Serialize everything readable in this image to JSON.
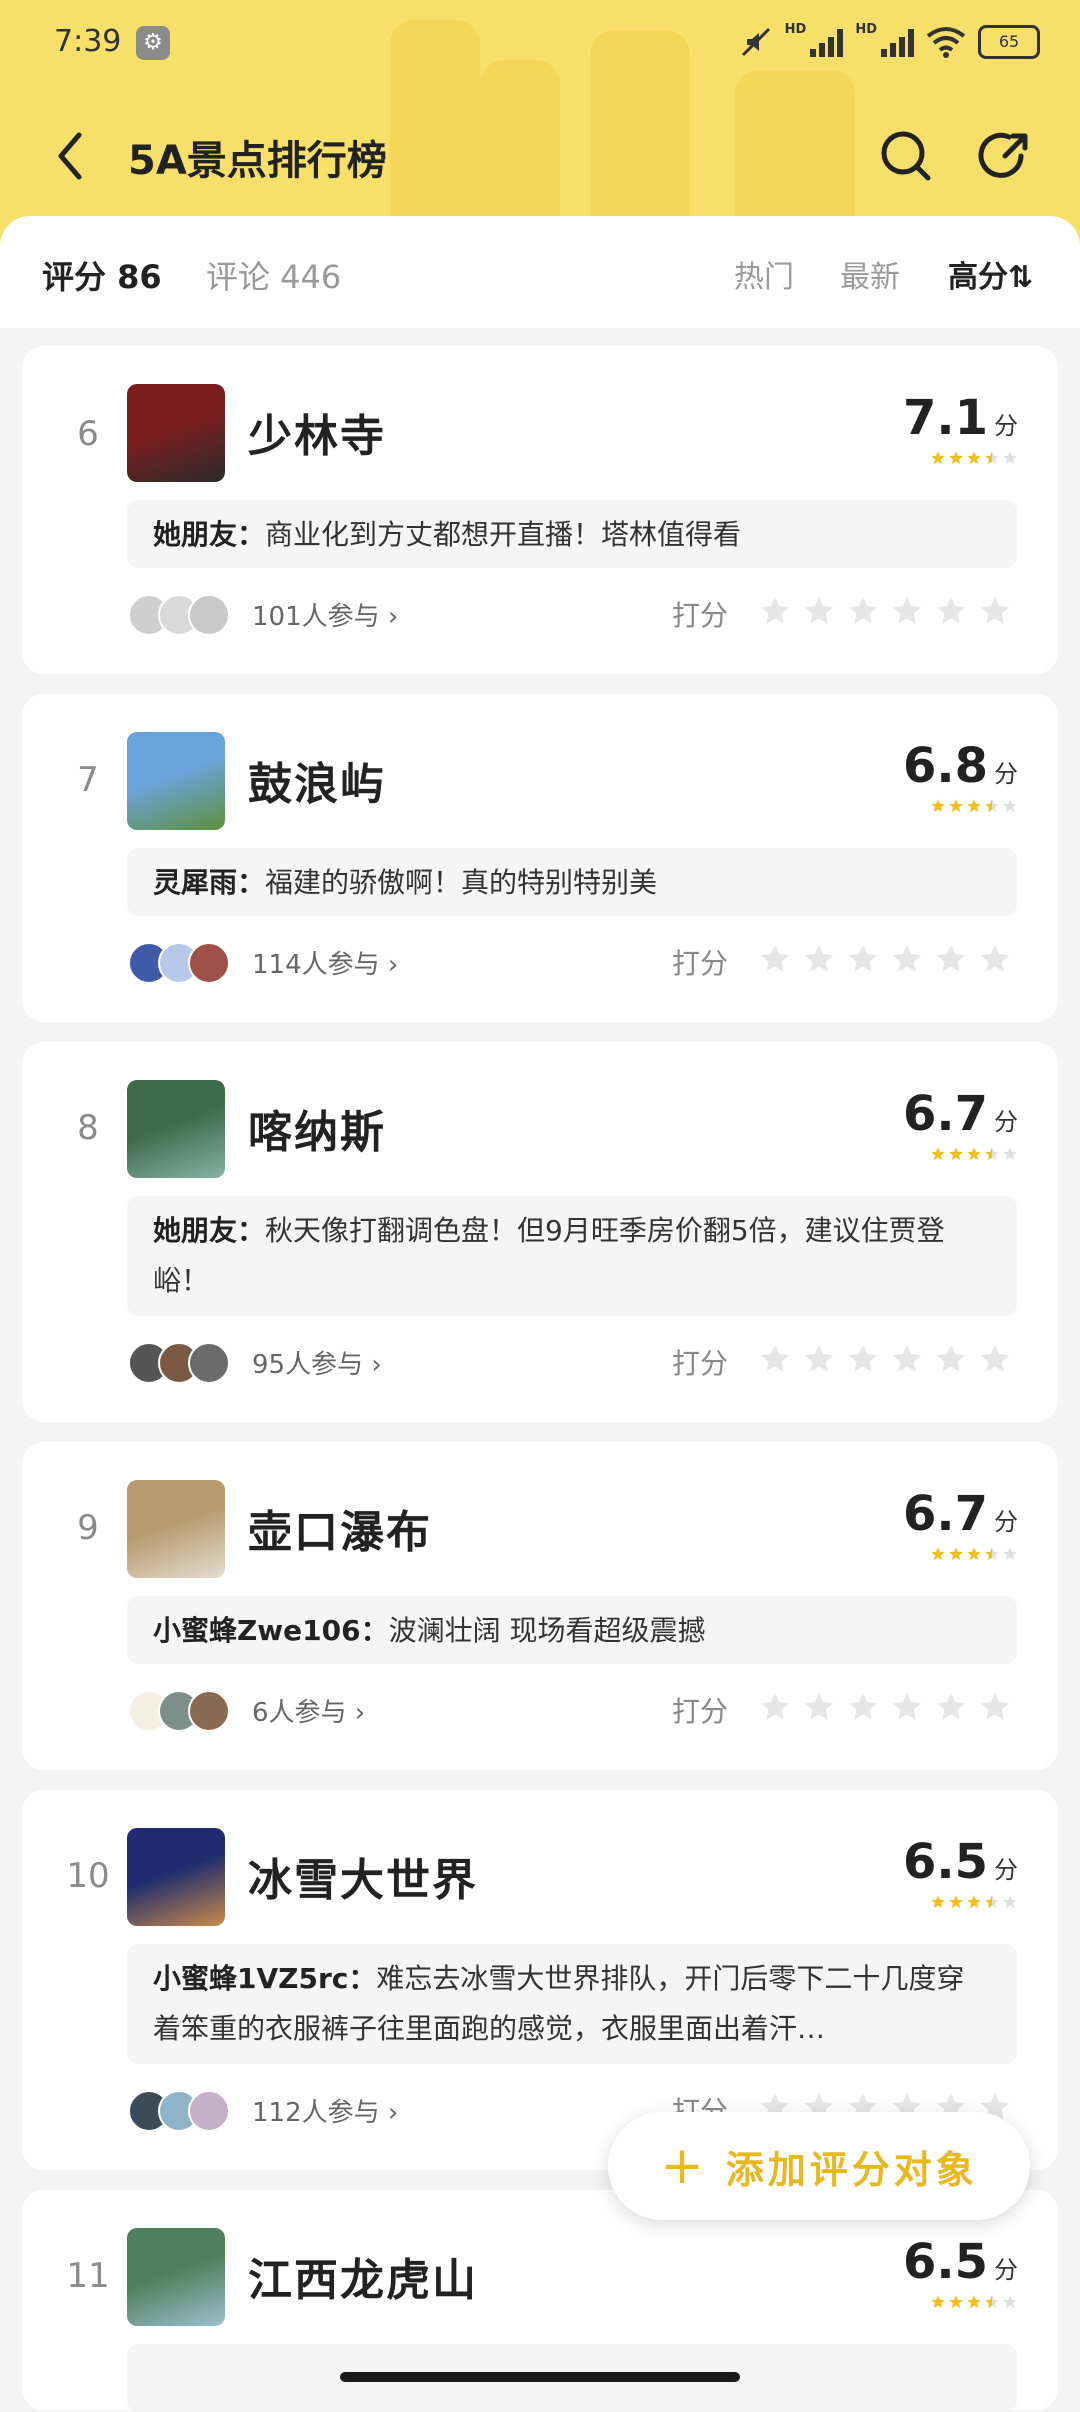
{
  "status": {
    "time": "7:39",
    "hd1": "HD",
    "hd2": "HD",
    "battery": "65"
  },
  "nav": {
    "title": "5A景点排行榜"
  },
  "sortbar": {
    "score_stat": "评分 86",
    "comment_stat": "评论 446",
    "tabs": [
      "热门",
      "最新",
      "高分⇅"
    ]
  },
  "rate_label": "打分",
  "items": [
    {
      "rank": "6",
      "name": "少林寺",
      "score": "7.1",
      "unit": "分",
      "stars": 3.5,
      "author": "她朋友：",
      "comment": "商业化到方丈都想开直播！塔林值得看",
      "participants": "101人参与 ›",
      "avatar_colors": [
        "#cfcfcf",
        "#d9d9d9",
        "#c9c9c9"
      ],
      "thumb_colors": [
        "#7a1e1e",
        "#2b2b2b"
      ]
    },
    {
      "rank": "7",
      "name": "鼓浪屿",
      "score": "6.8",
      "unit": "分",
      "stars": 3.5,
      "author": "灵犀雨：",
      "comment": "福建的骄傲啊！真的特别特别美",
      "participants": "114人参与 ›",
      "avatar_colors": [
        "#3f5aa8",
        "#b7c9e8",
        "#a0504a"
      ],
      "thumb_colors": [
        "#6aa4d8",
        "#5e8f3c"
      ]
    },
    {
      "rank": "8",
      "name": "喀纳斯",
      "score": "6.7",
      "unit": "分",
      "stars": 3.5,
      "author": "她朋友：",
      "comment": "秋天像打翻调色盘！但9月旺季房价翻5倍，建议住贾登峪！",
      "participants": "95人参与 ›",
      "avatar_colors": [
        "#555555",
        "#7a5a45",
        "#6b6b6b"
      ],
      "thumb_colors": [
        "#3e6b4a",
        "#86b2a6"
      ]
    },
    {
      "rank": "9",
      "name": "壶口瀑布",
      "score": "6.7",
      "unit": "分",
      "stars": 3.5,
      "author": "小蜜蜂Zwe106：",
      "comment": "波澜壮阔 现场看超级震撼",
      "participants": "6人参与 ›",
      "avatar_colors": [
        "#f3efe3",
        "#7c8f88",
        "#8a6a55"
      ],
      "thumb_colors": [
        "#b89a6e",
        "#e4ddd0"
      ]
    },
    {
      "rank": "10",
      "name": "冰雪大世界",
      "score": "6.5",
      "unit": "分",
      "stars": 3.5,
      "author": "小蜜蜂1VZ5rc：",
      "comment": "难忘去冰雪大世界排队，开门后零下二十几度穿着笨重的衣服裤子往里面跑的感觉，衣服里面出着汗…",
      "participants": "112人参与 ›",
      "avatar_colors": [
        "#3b4b5a",
        "#8fb3c8",
        "#c4b0c8"
      ],
      "thumb_colors": [
        "#1f2d6e",
        "#c98a4a"
      ]
    },
    {
      "rank": "11",
      "name": "江西龙虎山",
      "score": "6.5",
      "unit": "分",
      "stars": 3.5,
      "author": "",
      "comment": "",
      "participants": "",
      "avatar_colors": [],
      "thumb_colors": [
        "#4f7f5a",
        "#9dbfd0"
      ]
    }
  ],
  "fab": {
    "plus": "+",
    "label": "添加评分对象"
  }
}
